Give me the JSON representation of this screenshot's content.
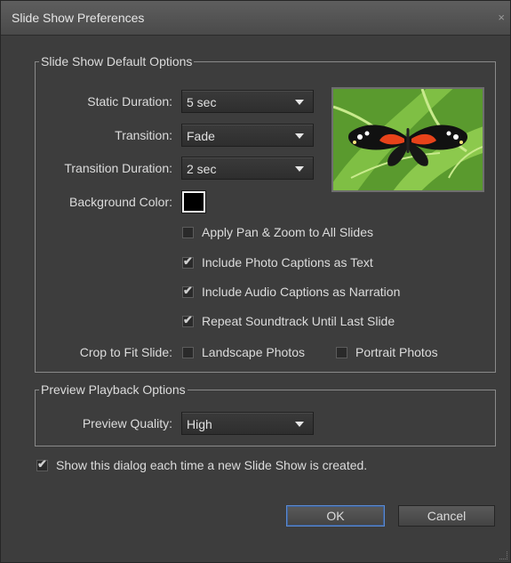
{
  "window": {
    "title": "Slide Show Preferences",
    "close_glyph": "×"
  },
  "default_options": {
    "legend": "Slide Show Default Options",
    "static_duration": {
      "label": "Static Duration:",
      "value": "5 sec"
    },
    "transition": {
      "label": "Transition:",
      "value": "Fade"
    },
    "transition_duration": {
      "label": "Transition Duration:",
      "value": "2 sec"
    },
    "background_color": {
      "label": "Background Color:",
      "color": "#000000"
    },
    "checkboxes": [
      {
        "label": "Apply Pan & Zoom to All Slides",
        "checked": false
      },
      {
        "label": "Include Photo Captions as Text",
        "checked": true
      },
      {
        "label": "Include Audio Captions as Narration",
        "checked": true
      },
      {
        "label": "Repeat Soundtrack Until Last Slide",
        "checked": true
      }
    ],
    "crop": {
      "label": "Crop to Fit Slide:",
      "landscape": {
        "label": "Landscape Photos",
        "checked": false
      },
      "portrait": {
        "label": "Portrait Photos",
        "checked": false
      }
    }
  },
  "preview_options": {
    "legend": "Preview Playback Options",
    "quality": {
      "label": "Preview Quality:",
      "value": "High"
    }
  },
  "show_dialog": {
    "label": "Show this dialog each time a new Slide Show is created.",
    "checked": true
  },
  "buttons": {
    "ok": "OK",
    "cancel": "Cancel"
  },
  "icons": {
    "checkmark": "✔"
  }
}
